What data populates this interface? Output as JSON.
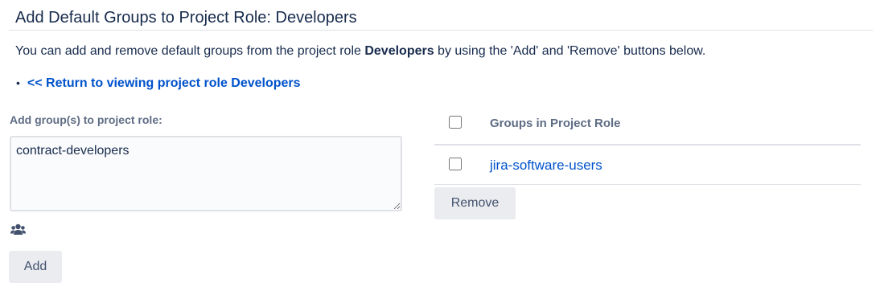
{
  "page": {
    "title": "Add Default Groups to Project Role: Developers",
    "intro": {
      "before": "You can add and remove default groups from the project role ",
      "role_name": "Developers",
      "after": " by using the 'Add' and 'Remove' buttons below."
    },
    "return_link": "<< Return to viewing project role Developers"
  },
  "add_form": {
    "label": "Add group(s) to project role:",
    "textarea_value": "contract-developers",
    "picker_icon": "group-picker-icon",
    "add_label": "Add"
  },
  "groups_table": {
    "column_header": "Groups in Project Role",
    "rows": [
      {
        "name": "jira-software-users",
        "checked": false
      }
    ],
    "remove_label": "Remove"
  },
  "colors": {
    "link": "#0052cc",
    "text": "#172b4d",
    "muted": "#5e6c84",
    "button_bg": "#ebecf0",
    "border": "#dfe1e6"
  }
}
